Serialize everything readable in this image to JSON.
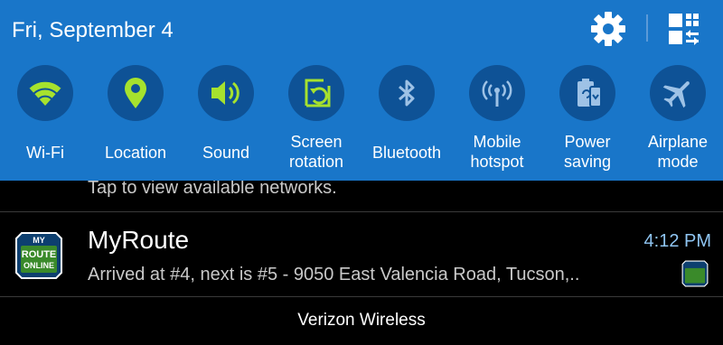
{
  "status": {
    "date": "Fri, September 4"
  },
  "toggles": [
    {
      "label": "Wi-Fi",
      "icon": "wifi-icon",
      "active": true
    },
    {
      "label": "Location",
      "icon": "location-pin-icon",
      "active": true
    },
    {
      "label": "Sound",
      "icon": "speaker-icon",
      "active": true
    },
    {
      "label": "Screen rotation",
      "icon": "rotation-icon",
      "active": true
    },
    {
      "label": "Bluetooth",
      "icon": "bluetooth-icon",
      "active": false
    },
    {
      "label": "Mobile hotspot",
      "icon": "hotspot-icon",
      "active": false
    },
    {
      "label": "Power saving",
      "icon": "power-saving-icon",
      "active": false
    },
    {
      "label": "Airplane mode",
      "icon": "airplane-icon",
      "active": false
    }
  ],
  "colors": {
    "panel": "#1976c9",
    "tile_bg": "#0e5296",
    "active_icon": "#a6e22e",
    "inactive_icon": "#9ec2e6"
  },
  "notifications": {
    "wifi_hint": "Tap to view available networks.",
    "myroute": {
      "title": "MyRoute",
      "time": "4:12 PM",
      "text": "Arrived at #4, next is #5 - 9050 East Valencia Road, Tucson,..",
      "logo": {
        "top": "MY",
        "mid": "ROUTE",
        "bottom": "ONLINE"
      }
    }
  },
  "carrier": "Verizon Wireless"
}
